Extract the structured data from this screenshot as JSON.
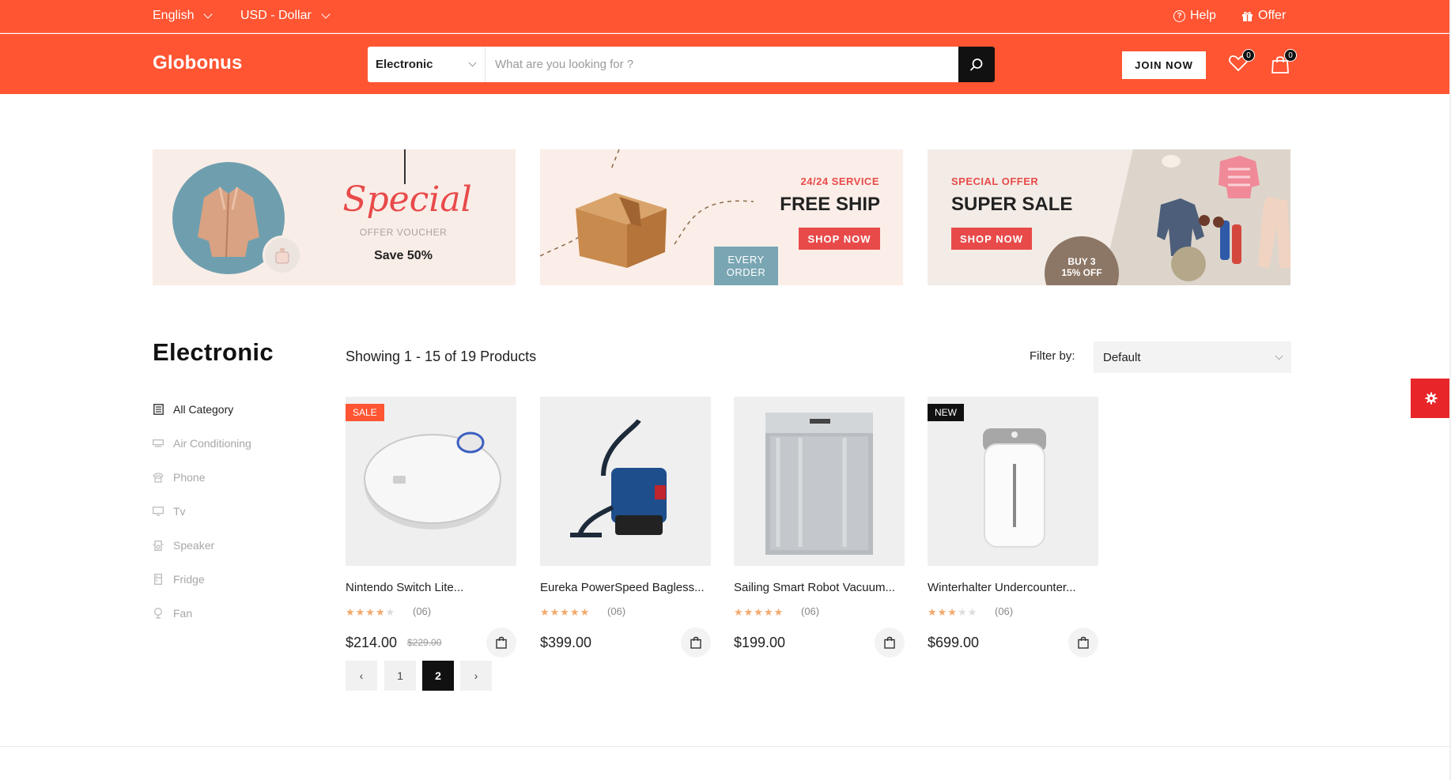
{
  "topbar": {
    "language": "English",
    "currency": "USD - Dollar",
    "help": "Help",
    "offer": "Offer"
  },
  "header": {
    "logo": "Globonus",
    "search_category": "Electronic",
    "search_placeholder": "What are you looking for ?",
    "join_label": "JOIN NOW",
    "wishlist_count": "0",
    "cart_count": "0"
  },
  "banners": {
    "b1": {
      "script": "Special",
      "sub": "OFFER VOUCHER",
      "save": "Save 50%"
    },
    "b2": {
      "kicker": "24/24 SERVICE",
      "title": "FREE SHIP",
      "button": "SHOP NOW",
      "badge_line1": "EVERY",
      "badge_line2": "ORDER"
    },
    "b3": {
      "kicker": "SPECIAL OFFER",
      "title": "SUPER SALE",
      "button": "SHOP NOW",
      "badge_line1": "BUY 3",
      "badge_line2": "15% OFF"
    }
  },
  "sidebar": {
    "title": "Electronic",
    "items": [
      {
        "label": "All Category",
        "icon": "list-icon"
      },
      {
        "label": "Air Conditioning",
        "icon": "air-conditioner-icon"
      },
      {
        "label": "Phone",
        "icon": "phone-icon"
      },
      {
        "label": "Tv",
        "icon": "tv-icon"
      },
      {
        "label": "Speaker",
        "icon": "speaker-icon"
      },
      {
        "label": "Fridge",
        "icon": "fridge-icon"
      },
      {
        "label": "Fan",
        "icon": "fan-icon"
      }
    ]
  },
  "listing": {
    "showing": "Showing 1 - 15 of 19 Products",
    "filter_label": "Filter by:",
    "filter_value": "Default"
  },
  "products": [
    {
      "name": "Nintendo Switch Lite...",
      "rating": 4,
      "reviews": "(06)",
      "price": "$214.00",
      "old_price": "$229.00",
      "tag": "SALE",
      "image": "robot-vacuum"
    },
    {
      "name": "Eureka PowerSpeed Bagless...",
      "rating": 5,
      "reviews": "(06)",
      "price": "$399.00",
      "old_price": "",
      "tag": "",
      "image": "wet-dry-vacuum"
    },
    {
      "name": "Sailing Smart Robot Vacuum...",
      "rating": 5,
      "reviews": "(06)",
      "price": "$199.00",
      "old_price": "",
      "tag": "",
      "image": "dishwasher"
    },
    {
      "name": "Winterhalter Undercounter...",
      "rating": 3,
      "reviews": "(06)",
      "price": "$699.00",
      "old_price": "",
      "tag": "NEW",
      "image": "humidifier"
    }
  ],
  "pagination": {
    "prev": "‹",
    "pages": [
      "1",
      "2"
    ],
    "current": "2",
    "next": "›"
  },
  "colors": {
    "brand": "#ff5533",
    "accent_red": "#e84a4a",
    "dark": "#111111",
    "star": "#f3a96b"
  }
}
